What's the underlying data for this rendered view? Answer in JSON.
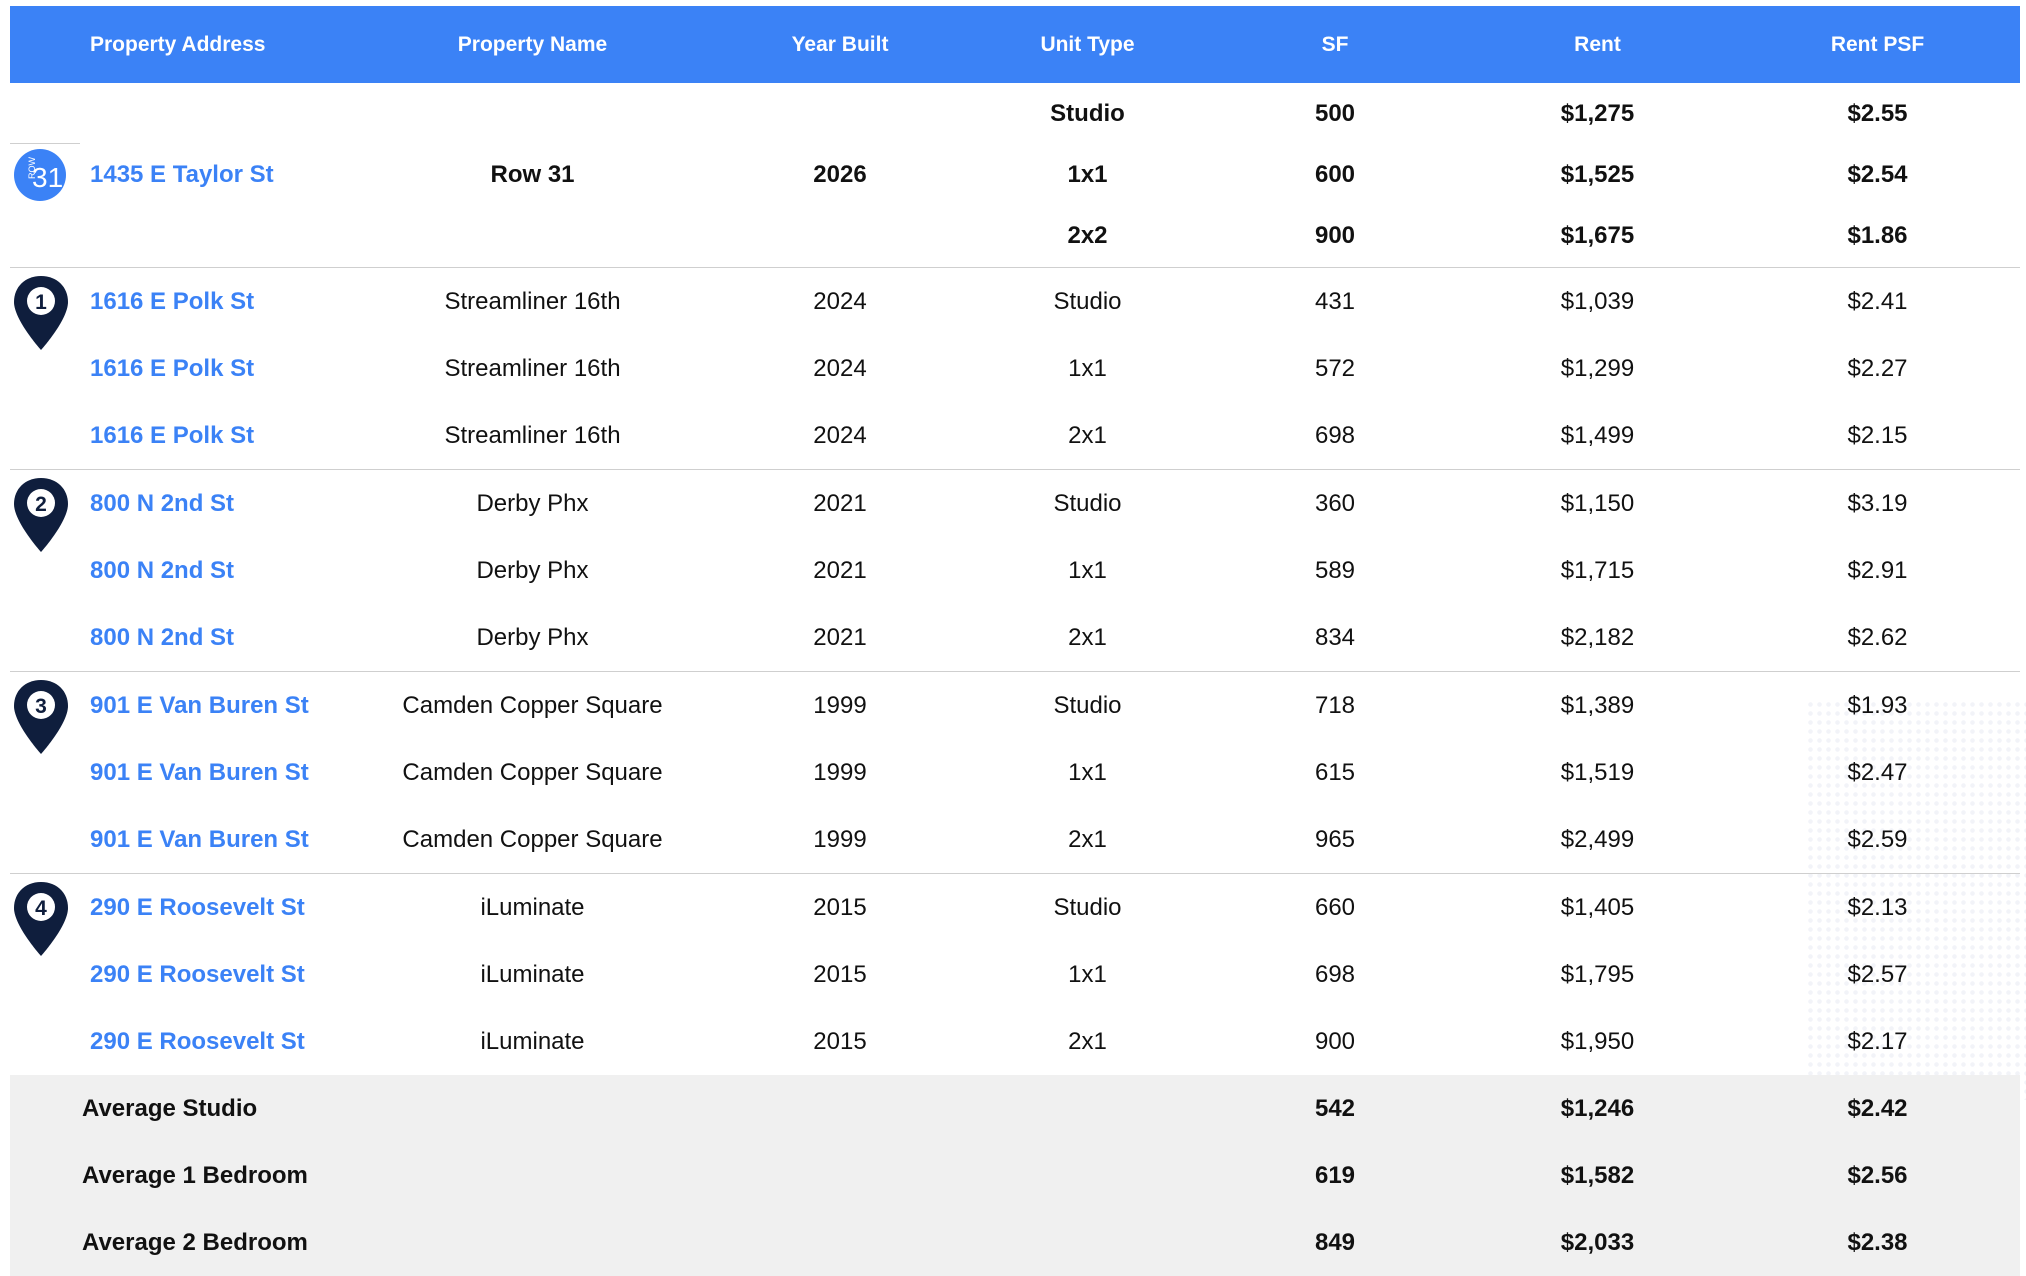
{
  "colors": {
    "header_bg": "#3B82F6",
    "link": "#3B82F6",
    "pin": "#0F1E3D",
    "avg_bg": "#F0F0F0"
  },
  "headers": {
    "address": "Property Address",
    "name": "Property Name",
    "year": "Year Built",
    "unit": "Unit Type",
    "sf": "SF",
    "rent": "Rent",
    "psf": "Rent PSF"
  },
  "subject": {
    "logo_text": "31",
    "logo_small": "ROW",
    "address": "1435 E Taylor St",
    "name": "Row 31",
    "year": "2026",
    "units": [
      {
        "type": "Studio",
        "sf": "500",
        "rent": "$1,275",
        "psf": "$2.55"
      },
      {
        "type": "1x1",
        "sf": "600",
        "rent": "$1,525",
        "psf": "$2.54"
      },
      {
        "type": "2x2",
        "sf": "900",
        "rent": "$1,675",
        "psf": "$1.86"
      }
    ]
  },
  "comps": [
    {
      "marker": "1",
      "rows": [
        {
          "address": "1616 E Polk St",
          "name": "Streamliner 16th",
          "year": "2024",
          "type": "Studio",
          "sf": "431",
          "rent": "$1,039",
          "psf": "$2.41"
        },
        {
          "address": "1616 E Polk St",
          "name": "Streamliner 16th",
          "year": "2024",
          "type": "1x1",
          "sf": "572",
          "rent": "$1,299",
          "psf": "$2.27"
        },
        {
          "address": "1616 E Polk St",
          "name": "Streamliner 16th",
          "year": "2024",
          "type": "2x1",
          "sf": "698",
          "rent": "$1,499",
          "psf": "$2.15"
        }
      ]
    },
    {
      "marker": "2",
      "rows": [
        {
          "address": "800 N 2nd St",
          "name": "Derby Phx",
          "year": "2021",
          "type": "Studio",
          "sf": "360",
          "rent": "$1,150",
          "psf": "$3.19"
        },
        {
          "address": "800 N 2nd St",
          "name": "Derby Phx",
          "year": "2021",
          "type": "1x1",
          "sf": "589",
          "rent": "$1,715",
          "psf": "$2.91"
        },
        {
          "address": "800 N 2nd St",
          "name": "Derby Phx",
          "year": "2021",
          "type": "2x1",
          "sf": "834",
          "rent": "$2,182",
          "psf": "$2.62"
        }
      ]
    },
    {
      "marker": "3",
      "rows": [
        {
          "address": "901 E Van Buren St",
          "name": "Camden Copper Square",
          "year": "1999",
          "type": "Studio",
          "sf": "718",
          "rent": "$1,389",
          "psf": "$1.93"
        },
        {
          "address": "901 E Van Buren St",
          "name": "Camden Copper Square",
          "year": "1999",
          "type": "1x1",
          "sf": "615",
          "rent": "$1,519",
          "psf": "$2.47"
        },
        {
          "address": "901 E Van Buren St",
          "name": "Camden Copper Square",
          "year": "1999",
          "type": "2x1",
          "sf": "965",
          "rent": "$2,499",
          "psf": "$2.59"
        }
      ]
    },
    {
      "marker": "4",
      "rows": [
        {
          "address": "290 E Roosevelt St",
          "name": "iLuminate",
          "year": "2015",
          "type": "Studio",
          "sf": "660",
          "rent": "$1,405",
          "psf": "$2.13"
        },
        {
          "address": "290 E Roosevelt St",
          "name": "iLuminate",
          "year": "2015",
          "type": "1x1",
          "sf": "698",
          "rent": "$1,795",
          "psf": "$2.57"
        },
        {
          "address": "290 E Roosevelt St",
          "name": "iLuminate",
          "year": "2015",
          "type": "2x1",
          "sf": "900",
          "rent": "$1,950",
          "psf": "$2.17"
        }
      ]
    }
  ],
  "averages": [
    {
      "label": "Average Studio",
      "sf": "542",
      "rent": "$1,246",
      "psf": "$2.42"
    },
    {
      "label": "Average 1 Bedroom",
      "sf": "619",
      "rent": "$1,582",
      "psf": "$2.56"
    },
    {
      "label": "Average 2 Bedroom",
      "sf": "849",
      "rent": "$2,033",
      "psf": "$2.38"
    }
  ]
}
